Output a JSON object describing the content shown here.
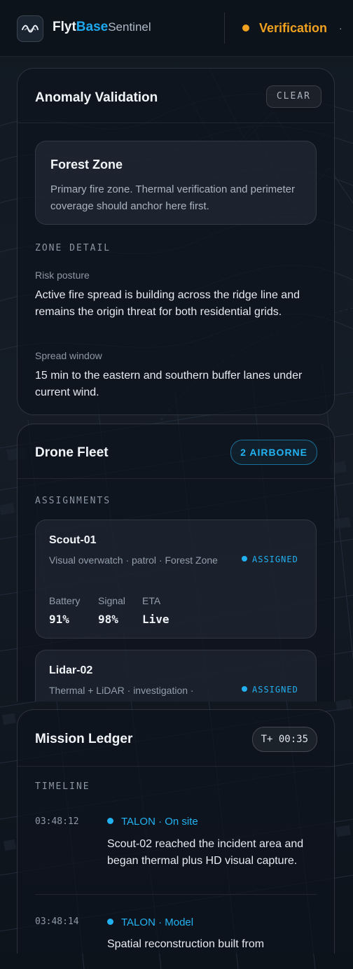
{
  "header": {
    "brand_flyt": "Flyt",
    "brand_base": "Base",
    "brand_sentinel": "Sentinel",
    "status_label": "Verification",
    "status_color": "#f0a11f"
  },
  "anomaly": {
    "title": "Anomaly Validation",
    "clear_label": "CLEAR",
    "zone_name": "Forest Zone",
    "zone_description": "Primary fire zone. Thermal verification and perimeter coverage should anchor here first.",
    "detail_label": "ZONE DETAIL",
    "risk_label": "Risk posture",
    "risk_value": "Active fire spread is building across the ridge line and remains the origin threat for both residential grids.",
    "spread_label": "Spread window",
    "spread_value": "15 min to the eastern and southern buffer lanes under current wind."
  },
  "fleet": {
    "title": "Drone Fleet",
    "badge": "2 AIRBORNE",
    "section_label": "ASSIGNMENTS",
    "drones": [
      {
        "name": "Scout-01",
        "description": "Visual overwatch · patrol · Forest Zone",
        "status": "ASSIGNED",
        "battery_label": "Battery",
        "battery": "91%",
        "signal_label": "Signal",
        "signal": "98%",
        "eta_label": "ETA",
        "eta": "Live"
      },
      {
        "name": "Lidar-02",
        "description": "Thermal + LiDAR · investigation ·",
        "status": "ASSIGNED"
      }
    ]
  },
  "ledger": {
    "title": "Mission Ledger",
    "timer": "T+ 00:35",
    "section_label": "TIMELINE",
    "entries": [
      {
        "time": "03:48:12",
        "source": "TALON",
        "event": "· On site",
        "text": "Scout-02 reached the incident area and began thermal plus HD visual capture."
      },
      {
        "time": "03:48:14",
        "source": "TALON",
        "event": "· Model",
        "text": "Spatial reconstruction built from"
      }
    ]
  },
  "colors": {
    "accent": "#1ea9ee",
    "warning": "#f0a11f",
    "background": "#0e141d"
  }
}
